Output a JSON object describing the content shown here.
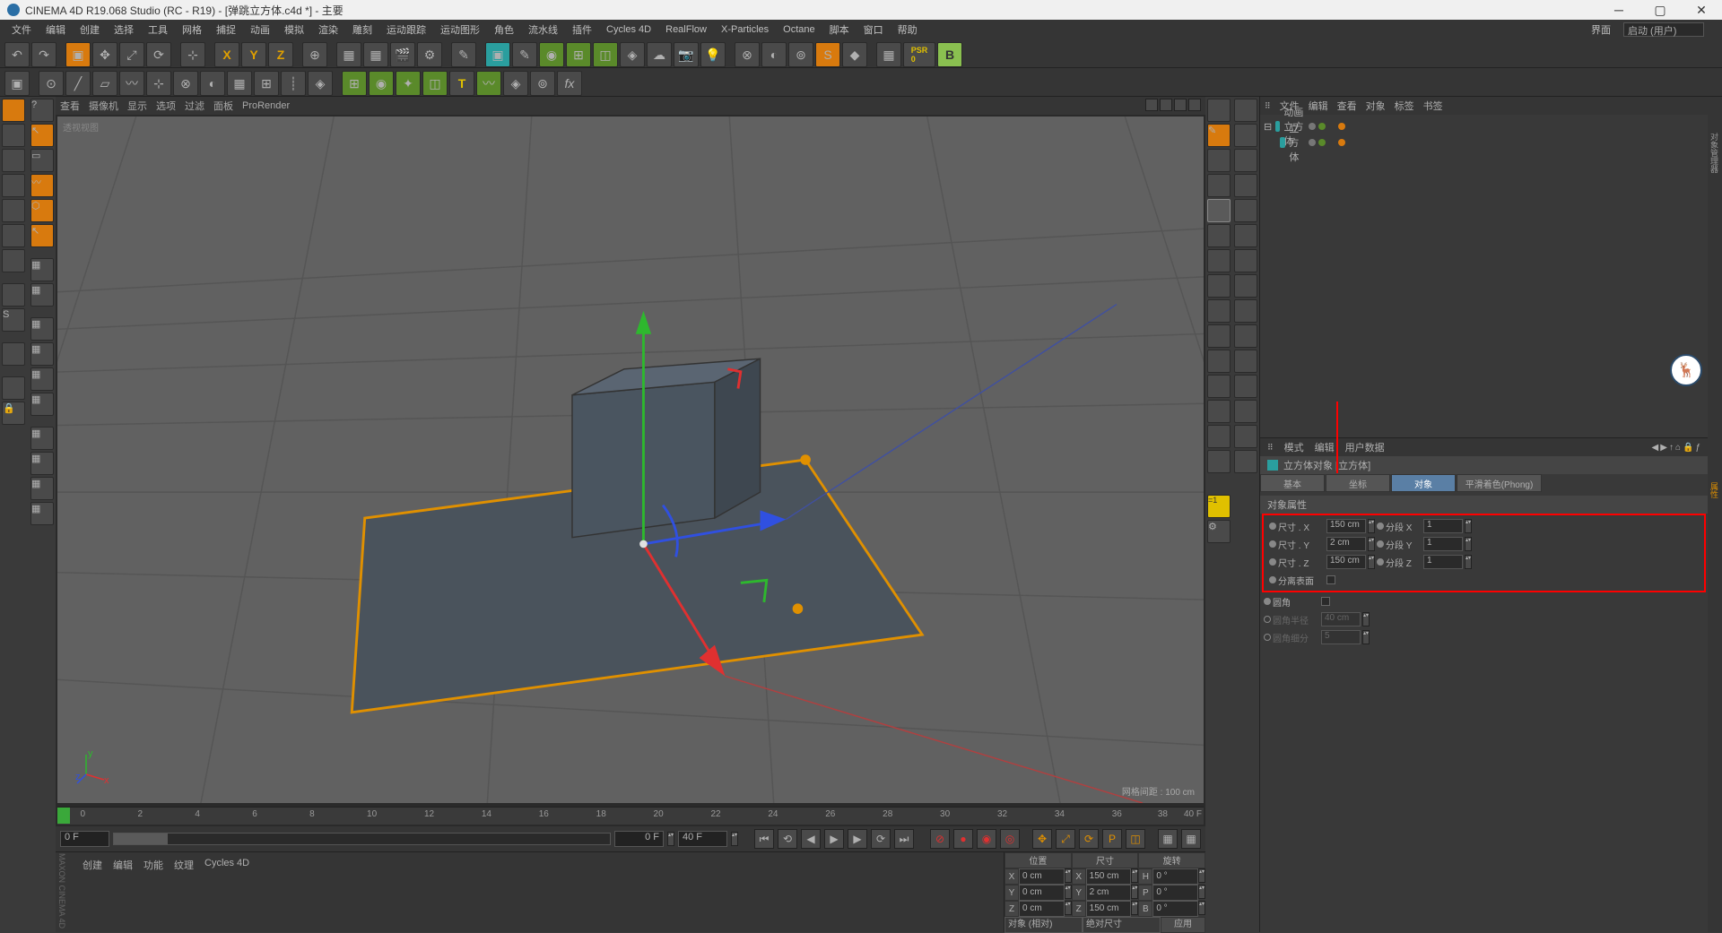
{
  "title": "CINEMA 4D R19.068 Studio (RC - R19) - [弹跳立方体.c4d *] - 主要",
  "menu": [
    "文件",
    "编辑",
    "创建",
    "选择",
    "工具",
    "网格",
    "捕捉",
    "动画",
    "模拟",
    "渲染",
    "雕刻",
    "运动跟踪",
    "运动图形",
    "角色",
    "流水线",
    "插件",
    "Cycles 4D",
    "RealFlow",
    "X-Particles",
    "Octane",
    "脚本",
    "窗口",
    "帮助"
  ],
  "menu_right": {
    "layout_lbl": "界面",
    "layout_val": "启动 (用户)"
  },
  "vp_menu": [
    "查看",
    "摄像机",
    "显示",
    "选项",
    "过滤",
    "面板",
    "ProRender"
  ],
  "vp_label": "透视视图",
  "vp_info": "网格间距 : 100 cm",
  "timeline_ticks": [
    "0",
    "2",
    "4",
    "6",
    "8",
    "10",
    "12",
    "14",
    "16",
    "18",
    "20",
    "22",
    "24",
    "26",
    "28",
    "30",
    "32",
    "34",
    "36",
    "38",
    "40"
  ],
  "timeline_end": "40 F",
  "frame_start": "0 F",
  "frame_cur": "0 F",
  "frame_to": "40 F",
  "obj_panel_tabs": [
    "文件",
    "编辑",
    "查看",
    "对象",
    "标签",
    "书签"
  ],
  "tree": [
    {
      "name": "动画立方体",
      "indent": 0
    },
    {
      "name": "立方体",
      "indent": 1
    }
  ],
  "attr_header": [
    "模式",
    "编辑",
    "用户数据"
  ],
  "attr_title": "立方体对象 [立方体]",
  "attr_tabs": [
    {
      "label": "基本",
      "active": false
    },
    {
      "label": "坐标",
      "active": false
    },
    {
      "label": "对象",
      "active": true
    },
    {
      "label": "平滑着色(Phong)",
      "active": false
    }
  ],
  "attr_section": "对象属性",
  "props": {
    "sizeX_lbl": "尺寸 . X",
    "sizeX": "150 cm",
    "segX_lbl": "分段 X",
    "segX": "1",
    "sizeY_lbl": "尺寸 . Y",
    "sizeY": "2 cm",
    "segY_lbl": "分段 Y",
    "segY": "1",
    "sizeZ_lbl": "尺寸 . Z",
    "sizeZ": "150 cm",
    "segZ_lbl": "分段 Z",
    "segZ": "1",
    "separate_lbl": "分离表面",
    "fillet_lbl": "圆角",
    "fillet_r_lbl": "圆角半径",
    "fillet_r": "40 cm",
    "fillet_s_lbl": "圆角细分",
    "fillet_s": "5"
  },
  "bottom_tabs": [
    "创建",
    "编辑",
    "功能",
    "纹理",
    "Cycles 4D"
  ],
  "coord": {
    "hdr_pos": "位置",
    "hdr_size": "尺寸",
    "hdr_rot": "旋转",
    "x_p": "0 cm",
    "x_s": "150 cm",
    "x_r": "0 °",
    "y_p": "0 cm",
    "y_s": "2 cm",
    "y_r": "0 °",
    "z_p": "0 cm",
    "z_s": "150 cm",
    "z_r": "0 °",
    "mode_obj": "对象 (相对)",
    "mode_size": "绝对尺寸",
    "apply": "应用",
    "rot_axes": [
      "H",
      "P",
      "B"
    ]
  },
  "vertical_brand": "MAXON   CINEMA 4D"
}
